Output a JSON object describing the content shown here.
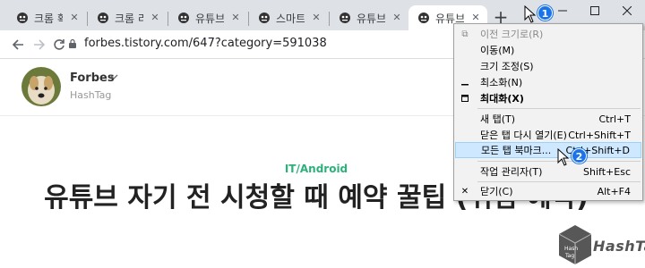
{
  "browser": {
    "tabs": [
      {
        "title": "크롬 확장"
      },
      {
        "title": "크롬 리스"
      },
      {
        "title": "유튜브 재"
      },
      {
        "title": "스마트폰"
      },
      {
        "title": "유튜브 광"
      },
      {
        "title": "유튜브 자"
      }
    ],
    "new_tab_label": "+",
    "url": "forbes.tistory.com/647?category=591038"
  },
  "badges": {
    "one": "1",
    "two": "2"
  },
  "context_menu": {
    "restore": "이전 크기로(R)",
    "move": "이동(M)",
    "resize": "크기 조정(S)",
    "minimize": "최소화(N)",
    "maximize": "최대화(X)",
    "new_tab": {
      "label": "새 탭(T)",
      "shortcut": "Ctrl+T"
    },
    "reopen_tab": {
      "label": "닫은 탭 다시 열기(E)",
      "shortcut": "Ctrl+Shift+T"
    },
    "bookmark_all": {
      "label": "모든 탭 북마크...",
      "shortcut": "Ctrl+Shift+D"
    },
    "task_manager": {
      "label": "작업 관리자(T)",
      "shortcut": "Shift+Esc"
    },
    "close": {
      "label": "닫기(C)",
      "shortcut": "Alt+F4"
    }
  },
  "blog": {
    "name": "Forbes",
    "tagline": "HashTag",
    "category": "IT/Android",
    "post_title": "유튜브 자기 전 시청할 때 예약 꿀팁 (취침 예약)"
  },
  "watermark": {
    "text": "HashTag"
  },
  "colors": {
    "accent_green": "#2db17b",
    "badge_blue": "#1a73e8",
    "menu_highlight": "#cde8ff"
  }
}
